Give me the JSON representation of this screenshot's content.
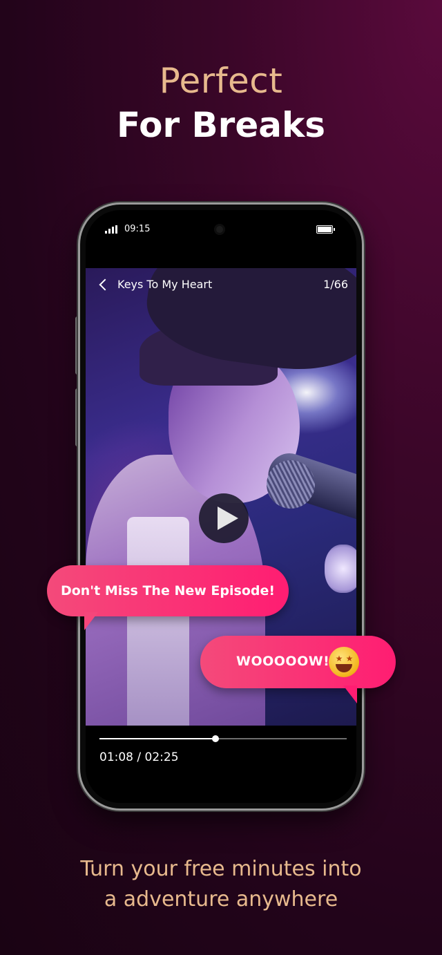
{
  "headline": {
    "line1": "Perfect",
    "line2": "For Breaks"
  },
  "status_bar": {
    "time": "09:15",
    "signal_icon": "signal-bars-icon",
    "battery_icon": "battery-full-icon"
  },
  "player": {
    "back_icon": "chevron-left-icon",
    "title": "Keys To My Heart",
    "episode_counter": "1/66",
    "play_icon": "play-icon",
    "timecode": "01:08 / 02:25",
    "progress_fraction": 0.47
  },
  "bubbles": {
    "bubble1": "Don't Miss The New Episode!",
    "bubble2": "WOOOOOW!",
    "bubble2_emoji": "star-struck-emoji-icon"
  },
  "tagline": {
    "line1": "Turn your free minutes into",
    "line2": "a adventure anywhere"
  },
  "colors": {
    "accent_pink": "#ff1d72",
    "gold": "#e7b98d",
    "background": "#3a0628"
  }
}
